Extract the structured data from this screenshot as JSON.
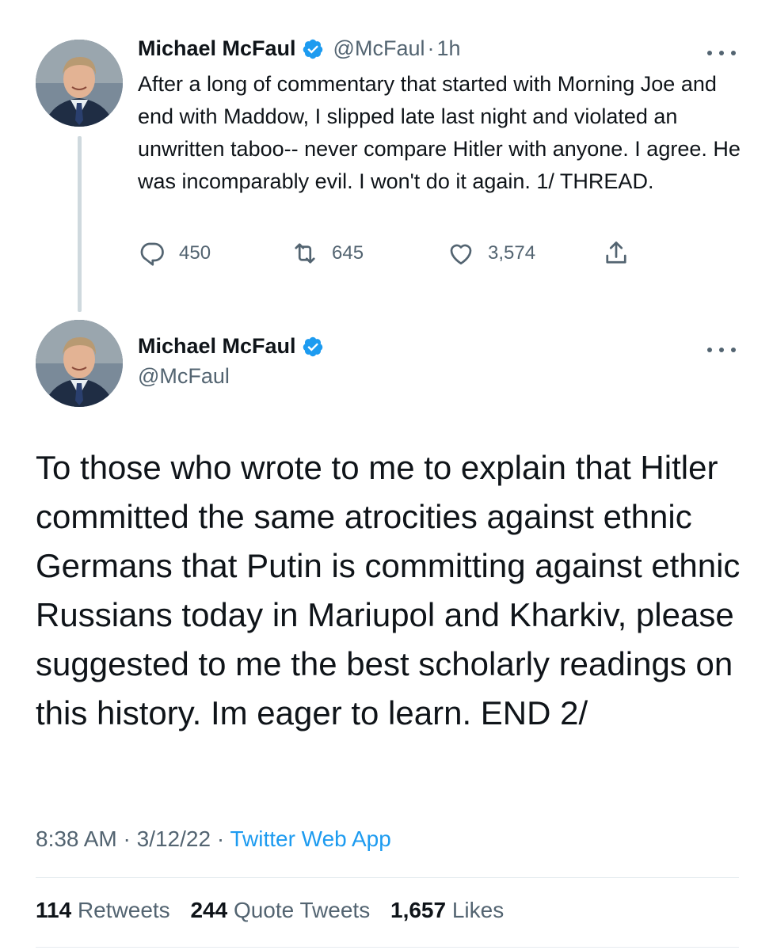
{
  "colors": {
    "link": "#1d9bf0",
    "verified": "#1d9bf0",
    "secondary_text": "#536471",
    "primary_text": "#0f1419"
  },
  "tweet1": {
    "display_name": "Michael McFaul",
    "handle": "@McFaul",
    "separator": "·",
    "time": "1h",
    "text": "After a long of commentary that started with Morning Joe and end with Maddow, I slipped late last night and violated an unwritten taboo-- never compare Hitler with anyone. I agree. He was incomparably evil. I won't do it again. 1/ THREAD.",
    "replies": "450",
    "retweets": "645",
    "likes": "3,574",
    "icons": [
      "reply-icon",
      "retweet-icon",
      "like-icon",
      "share-icon",
      "more-icon",
      "verified-icon"
    ]
  },
  "tweet2": {
    "display_name": "Michael McFaul",
    "handle": "@McFaul",
    "text": "To those who wrote to me to explain that Hitler committed the same atrocities against ethnic Germans that Putin is committing against ethnic Russians today in Mariupol and Kharkiv, please suggested to me the best scholarly readings on this history. Im eager to learn. END 2/",
    "time": "8:38 AM",
    "separator": "·",
    "date": "3/12/22",
    "app": "Twitter Web App",
    "stats": {
      "retweets_count": "114",
      "retweets_label": "Retweets",
      "quote_count": "244",
      "quote_label": "Quote Tweets",
      "likes_count": "1,657",
      "likes_label": "Likes"
    }
  }
}
